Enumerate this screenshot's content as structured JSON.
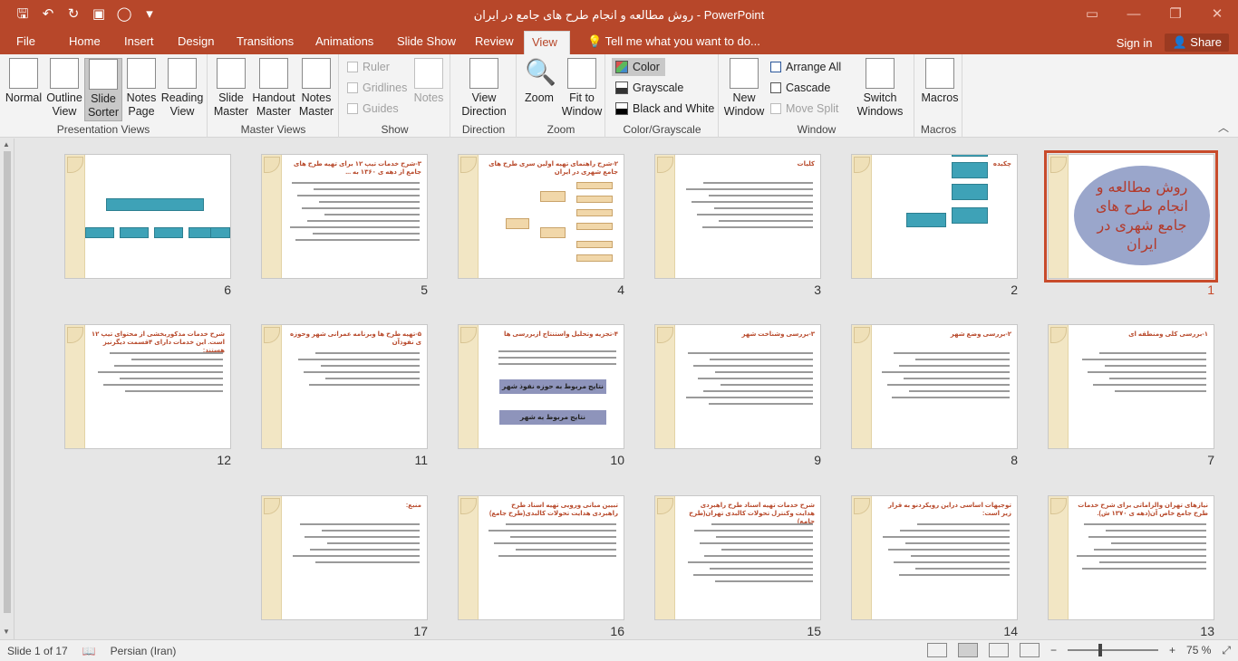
{
  "window": {
    "title": "روش مطالعه و انجام طرح های جامع در ایران  -  PowerPoint",
    "qat_icons": [
      "save-icon",
      "undo-icon",
      "redo-icon",
      "present-icon",
      "record-icon",
      "customize-icon"
    ],
    "accent": "#b7472a"
  },
  "tabs": [
    "File",
    "Home",
    "Insert",
    "Design",
    "Transitions",
    "Animations",
    "Slide Show",
    "Review",
    "View"
  ],
  "active_tab": "View",
  "tell_me": "Tell me what you want to do...",
  "sign_in": "Sign in",
  "share": "Share",
  "ribbon": {
    "presentation_views": {
      "label": "Presentation Views",
      "normal": "Normal",
      "outline": "Outline View",
      "outline_1": "Outline",
      "outline_2": "View",
      "sorter_1": "Slide",
      "sorter_2": "Sorter",
      "notes_1": "Notes",
      "notes_2": "Page",
      "reading_1": "Reading",
      "reading_2": "View"
    },
    "master_views": {
      "label": "Master Views",
      "slide_1": "Slide",
      "slide_2": "Master",
      "handout_1": "Handout",
      "handout_2": "Master",
      "notes_1": "Notes",
      "notes_2": "Master"
    },
    "show": {
      "label": "Show",
      "ruler": "Ruler",
      "gridlines": "Gridlines",
      "guides": "Guides",
      "notes": "Notes"
    },
    "direction": {
      "label": "Direction",
      "view_1": "View",
      "view_2": "Direction"
    },
    "zoom": {
      "label": "Zoom",
      "zoom": "Zoom",
      "fit_1": "Fit to",
      "fit_2": "Window"
    },
    "color": {
      "label": "Color/Grayscale",
      "color": "Color",
      "grayscale": "Grayscale",
      "bw": "Black and White"
    },
    "window": {
      "label": "Window",
      "new_1": "New",
      "new_2": "Window",
      "arrange": "Arrange All",
      "cascade": "Cascade",
      "move_split": "Move Split",
      "switch_1": "Switch",
      "switch_2": "Windows"
    },
    "macros": {
      "label": "Macros",
      "macros": "Macros"
    }
  },
  "slides": [
    {
      "num": "1",
      "title": "روش مطالعه و انجام طرح های جامع شهری در ایران",
      "kind": "title"
    },
    {
      "num": "2",
      "title": "چکیده",
      "kind": "diagram"
    },
    {
      "num": "3",
      "title": "کلیات",
      "kind": "text"
    },
    {
      "num": "4",
      "title": "۲-شرح راهنمای تهیه اولین سری طرح های جامع شهری در ایران",
      "kind": "tree"
    },
    {
      "num": "5",
      "title": "۳-شرح خدمات تیپ ۱۲ برای تهیه طرح های جامع از دهه ی ۱۳۶۰ به ...",
      "kind": "text"
    },
    {
      "num": "6",
      "title": "",
      "kind": "org"
    },
    {
      "num": "7",
      "title": "۱-بررسی کلی ومنطقه ای",
      "kind": "text"
    },
    {
      "num": "8",
      "title": "۲-بررسی وضع شهر",
      "kind": "text"
    },
    {
      "num": "9",
      "title": "۳-بررسی وشناخت شهر",
      "kind": "text"
    },
    {
      "num": "10",
      "title": "۴-تجزیه وتحلیل واستنتاج ازبررسی ها",
      "kind": "buttons",
      "btn1": "نتایج مربوط به حوزه نفوذ شهر",
      "btn2": "نتایج مربوط به شهر"
    },
    {
      "num": "11",
      "title": "۵-تهیه طرح ها وبرنامه عمرانی شهر وحوزه ی نفوذآن",
      "kind": "text"
    },
    {
      "num": "12",
      "title": "شرح خدمات مذکوربخشی از محتوای تیپ ۱۲ است. این خدمات دارای ۴قسمت دیگرنیز هستند:",
      "kind": "text"
    },
    {
      "num": "13",
      "title": "نیازهای تهران والزاماتی برای شرح خدمات طرح جامع خاص آن(دهه ی ۱۳۷۰ ش).",
      "kind": "text"
    },
    {
      "num": "14",
      "title": "توجیهات اساسی دراین رویکردنو به قرار زیر است:",
      "kind": "text"
    },
    {
      "num": "15",
      "title": "شرح خدمات تهیه اسناد طرح راهبردی هدایت وکنترل تحولات کالبدی تهران(طرح جامع)",
      "kind": "text"
    },
    {
      "num": "16",
      "title": "تبیین مبانی ورویی تهیه اسناد طرح راهبردی هدایت تحولات کالبدی(طرح جامع)",
      "kind": "text"
    },
    {
      "num": "17",
      "title": "منبع:",
      "kind": "text"
    }
  ],
  "status": {
    "slide_of": "Slide 1 of 17",
    "language": "Persian (Iran)",
    "zoom": "75 %"
  }
}
